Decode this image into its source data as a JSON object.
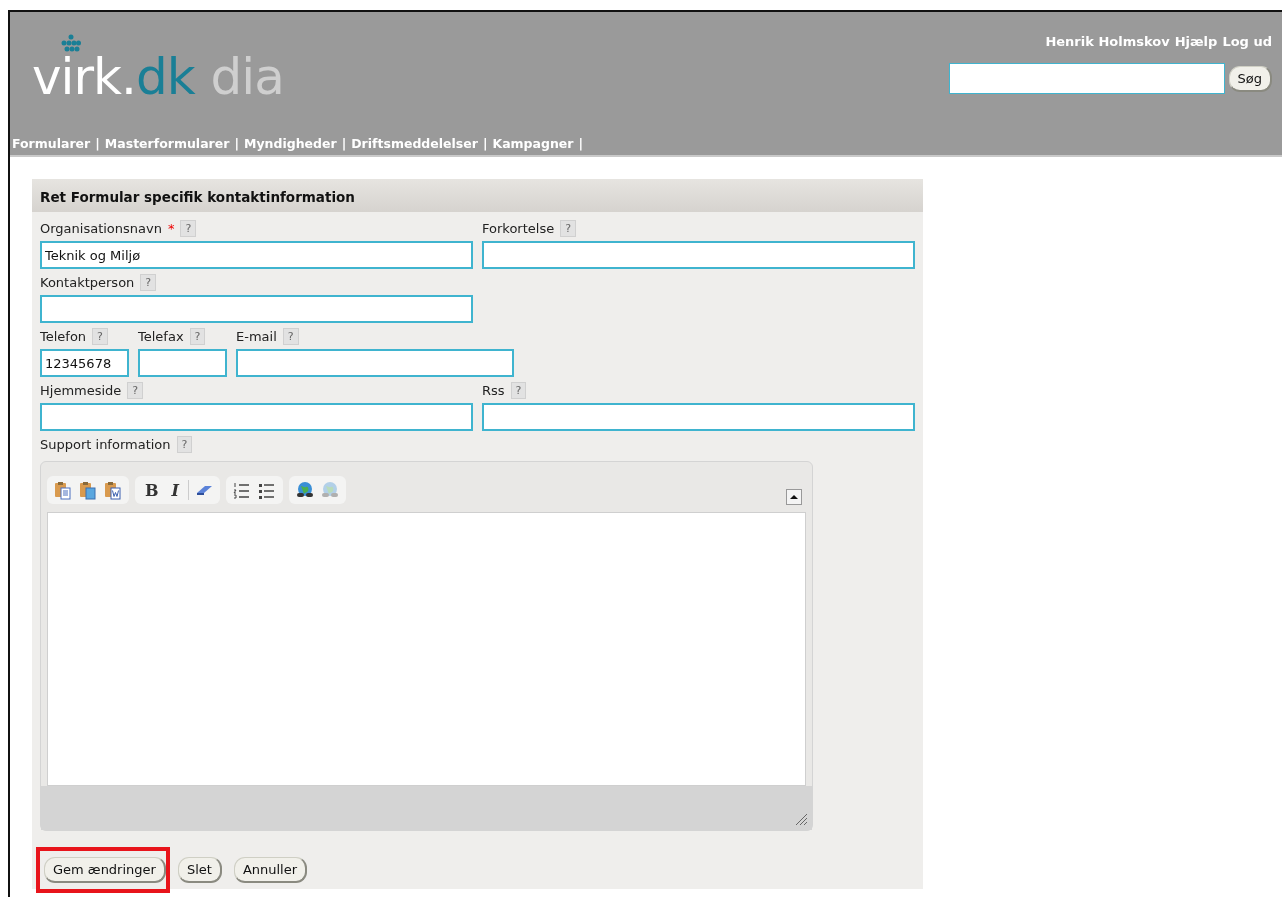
{
  "logo": {
    "part_1": "virk",
    "part_2": ".",
    "part_3": "dk",
    "part_4": "dia"
  },
  "user_links": [
    "Henrik Holmskov",
    "Hjælp",
    "Log ud"
  ],
  "search": {
    "button": "Søg"
  },
  "nav": [
    "Formularer",
    "Masterformularer",
    "Myndigheder",
    "Driftsmeddelelser",
    "Kampagner"
  ],
  "nav_separator": "|",
  "form": {
    "title": "Ret Formular specifik kontaktinformation",
    "rows": [
      [
        {
          "label": "Organisationsnavn",
          "required_mark": "*",
          "help": "?",
          "value": "Teknik og Miljø",
          "kind": "half"
        },
        {
          "label": "Forkortelse",
          "help": "?",
          "kind": "half"
        }
      ],
      [
        {
          "label": "Kontaktperson",
          "help": "?",
          "kind": "half"
        }
      ],
      [
        {
          "label": "Telefon",
          "help": "?",
          "value": "12345678",
          "kind": "small"
        },
        {
          "label": "Telefax",
          "help": "?",
          "kind": "small"
        },
        {
          "label": "E-mail",
          "help": "?",
          "kind": "medium"
        }
      ],
      [
        {
          "label": "Hjemmeside",
          "help": "?",
          "kind": "half"
        },
        {
          "label": "Rss",
          "help": "?",
          "kind": "half"
        }
      ]
    ],
    "support": {
      "label": "Support information",
      "help": "?",
      "toolbar": [
        [
          {
            "kind": "paste",
            "disabled": false
          },
          {
            "kind": "paste-text",
            "disabled": false
          },
          {
            "kind": "paste-word",
            "disabled": false
          }
        ],
        [
          {
            "kind": "bold",
            "label": "B",
            "disabled": false
          },
          {
            "kind": "italic",
            "label": "I",
            "disabled": false
          },
          {
            "kind": "separator"
          },
          {
            "kind": "eraser",
            "disabled": false
          }
        ],
        [
          {
            "kind": "ordered-list",
            "disabled": false
          },
          {
            "kind": "bullet-list",
            "disabled": false
          }
        ],
        [
          {
            "kind": "link",
            "disabled": false
          },
          {
            "kind": "unlink",
            "disabled": true
          }
        ]
      ]
    },
    "buttons": [
      {
        "label": "Gem ændringer",
        "highlighted": true
      },
      {
        "label": "Slet",
        "highlighted": false
      },
      {
        "label": "Annuller",
        "highlighted": false
      }
    ]
  }
}
